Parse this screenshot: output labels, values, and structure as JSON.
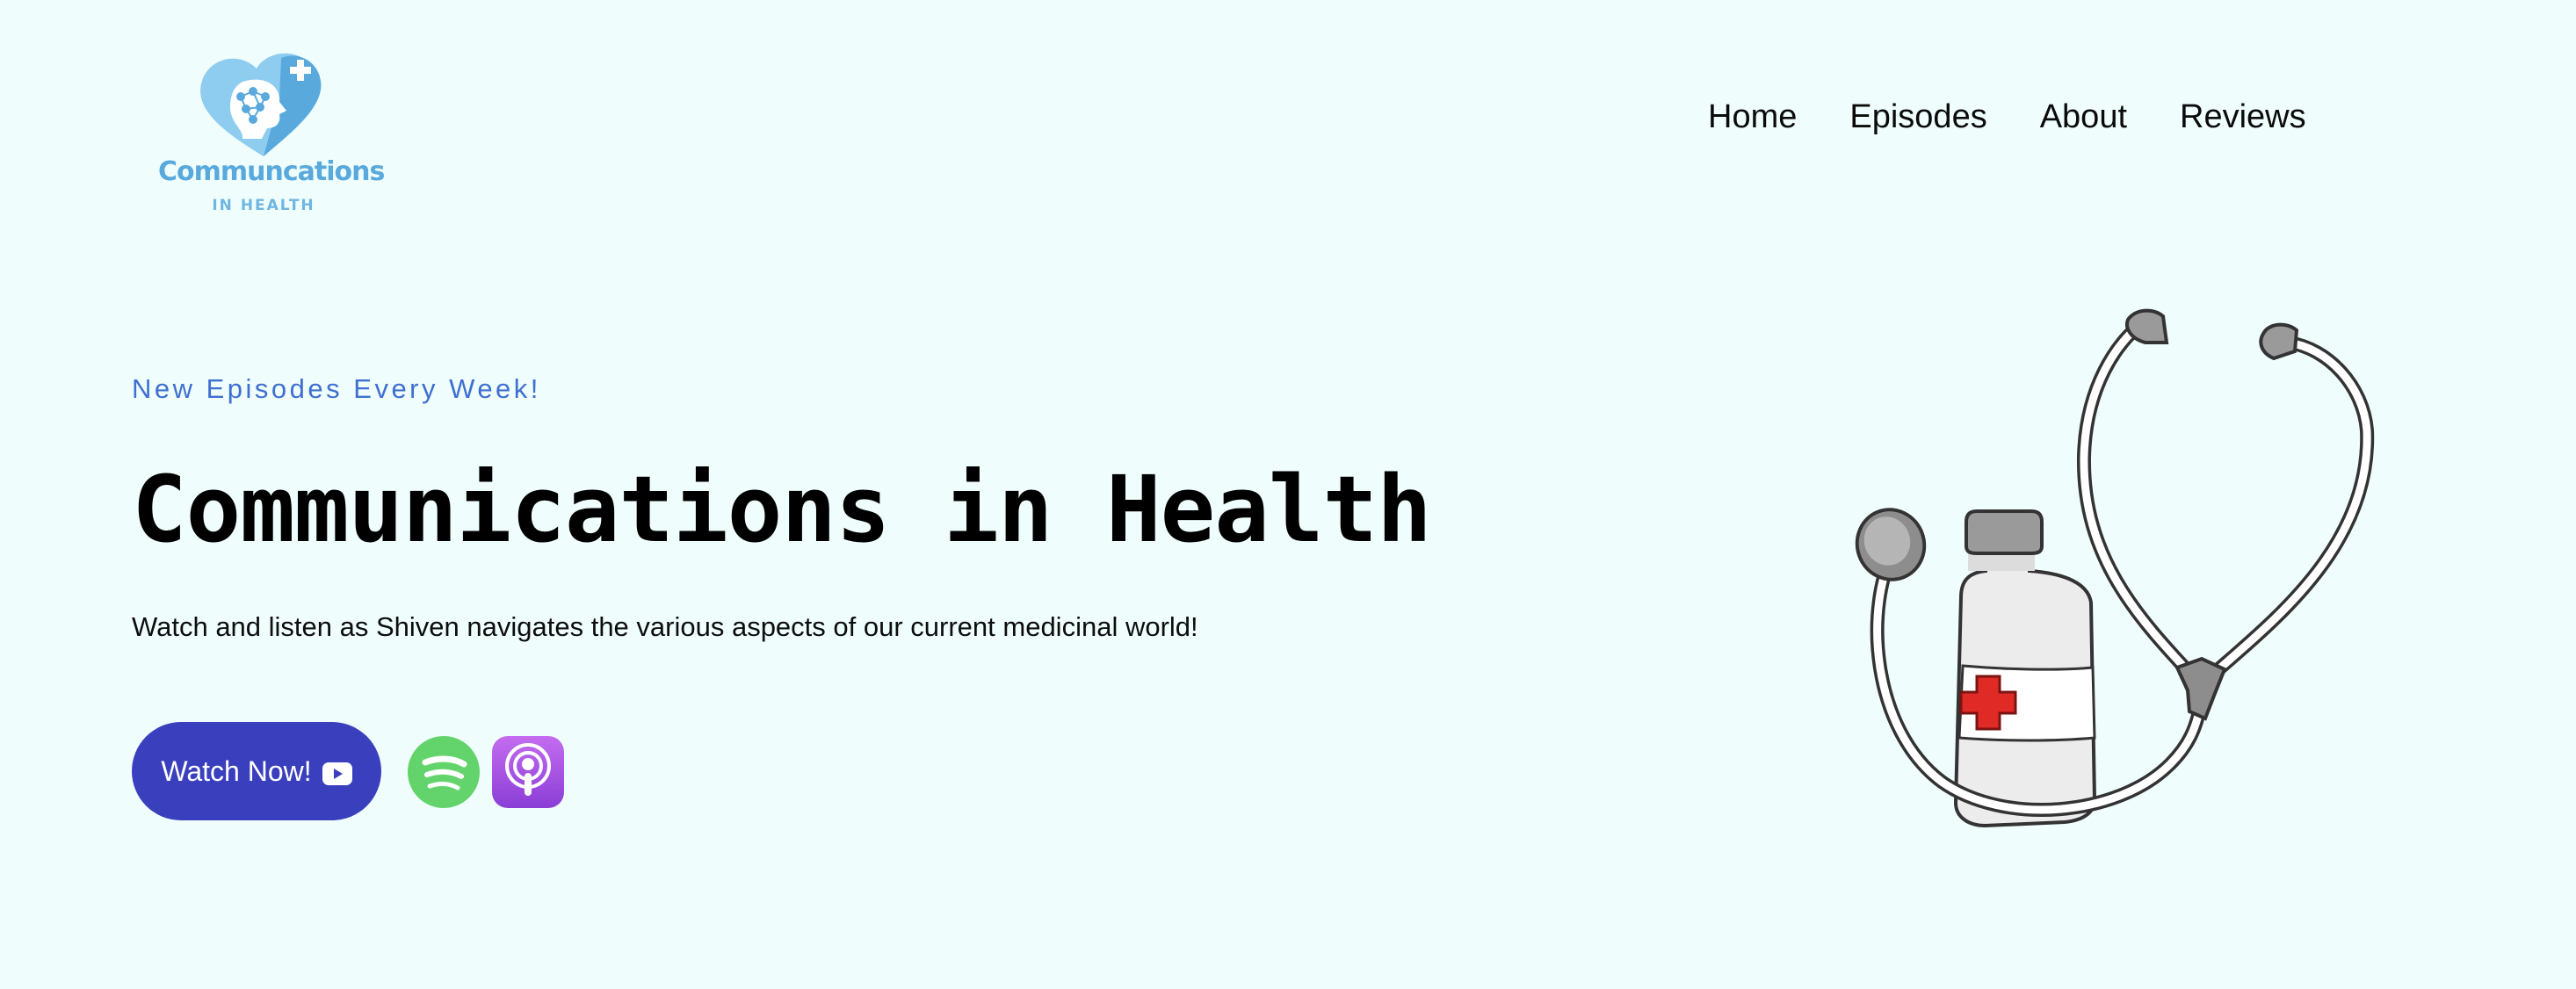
{
  "brand": {
    "name": "Communcations",
    "subtitle": "IN HEALTH",
    "logo_icon": "heart-brain-cross-logo",
    "color": "#5aa9dc"
  },
  "nav": {
    "items": [
      {
        "label": "Home"
      },
      {
        "label": "Episodes"
      },
      {
        "label": "About"
      },
      {
        "label": "Reviews"
      }
    ]
  },
  "hero": {
    "tagline": "New Episodes Every Week!",
    "title": "Communications in Health",
    "description": "Watch and listen as Shiven navigates the various aspects of our current medicinal world!",
    "watch_button": "Watch Now!",
    "watch_icon": "youtube-icon",
    "platform_icons": [
      "spotify-icon",
      "apple-podcasts-icon"
    ],
    "illustration": "stethoscope-medicine-bottle"
  },
  "colors": {
    "background": "#effefd",
    "accent": "#3a3fbd",
    "tagline": "#3f6fd0",
    "spotify": "#63d46b",
    "podcasts": "#9b4fe0"
  }
}
